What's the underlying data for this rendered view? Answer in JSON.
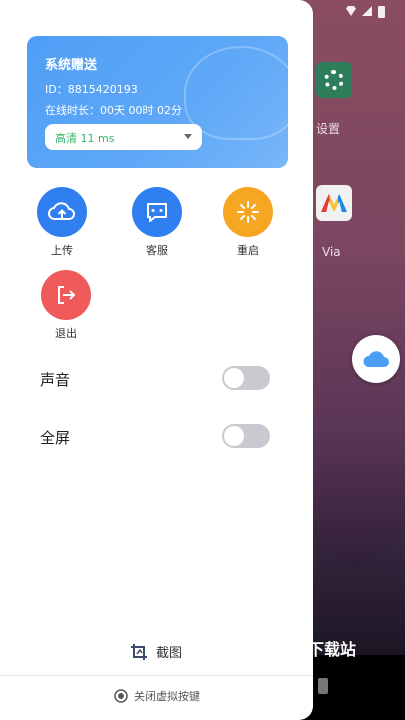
{
  "card": {
    "title": "系统赠送",
    "id_text": "ID：8815420193",
    "online_text": "在线时长：00天 00时 02分",
    "quality_selected": "高清 11 ms"
  },
  "actions": [
    {
      "label": "上传",
      "icon": "upload-cloud-icon",
      "color": "#2f7ff0"
    },
    {
      "label": "客服",
      "icon": "chat-icon",
      "color": "#2f7ff0"
    },
    {
      "label": "重启",
      "icon": "restart-icon",
      "color": "#f6a623"
    },
    {
      "label": "退出",
      "icon": "exit-icon",
      "color": "#f05a5a"
    }
  ],
  "settings": [
    {
      "label": "声音",
      "enabled": false
    },
    {
      "label": "全屏",
      "enabled": false
    }
  ],
  "footer": {
    "screenshot_label": "截图",
    "close_keys_label": "关闭虚拟按键"
  },
  "background": {
    "app_settings_label": "设置",
    "app_via_label": "Via",
    "watermark": "下载站"
  },
  "colors": {
    "accent": "#2f7ff0",
    "card_start": "#4f9ef6",
    "quality_text": "#34b36b",
    "toggle_off": "#c9c9d1"
  }
}
